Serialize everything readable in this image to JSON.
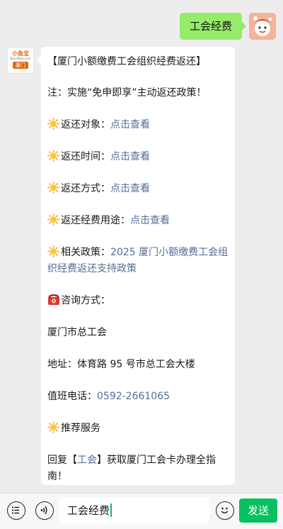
{
  "outgoing_message": "工会经费",
  "sender_logo": {
    "name": "小鱼宝",
    "site": "BendiBao.com",
    "city": "厦门"
  },
  "article": {
    "title": "【厦门小额缴费工会组织经费返还】",
    "note": "注：实施“免申即享”主动返还政策！",
    "items": [
      {
        "label": "返还对象：",
        "link": "点击查看"
      },
      {
        "label": "返还时间：",
        "link": "点击查看"
      },
      {
        "label": "返还方式：",
        "link": "点击查看"
      },
      {
        "label": "返还经费用途：",
        "link": "点击查看"
      }
    ],
    "policy_label": "相关政策：",
    "policy_link": "2025 厦门小额缴费工会组织经费返还支持政策",
    "consult_label": "咨询方式：",
    "org": "厦门市总工会",
    "address": "地址：体育路 95 号市总工会大楼",
    "phone_label": "值班电话：",
    "phone": "0592-2661065",
    "recommend": "推荐服务",
    "reply_prefix": "回复【",
    "reply_keyword": "工会",
    "reply_suffix": "】获取厦门工会卡办理全指南！"
  },
  "input_bar": {
    "voice_icon": "voice-icon",
    "menu_icon": "menu-icon",
    "input_value": "工会经费",
    "emoji_icon": "emoji-icon",
    "send_label": "发送"
  },
  "colors": {
    "bubble_out": "#95ec69",
    "link": "#576b95",
    "send": "#07c160"
  }
}
